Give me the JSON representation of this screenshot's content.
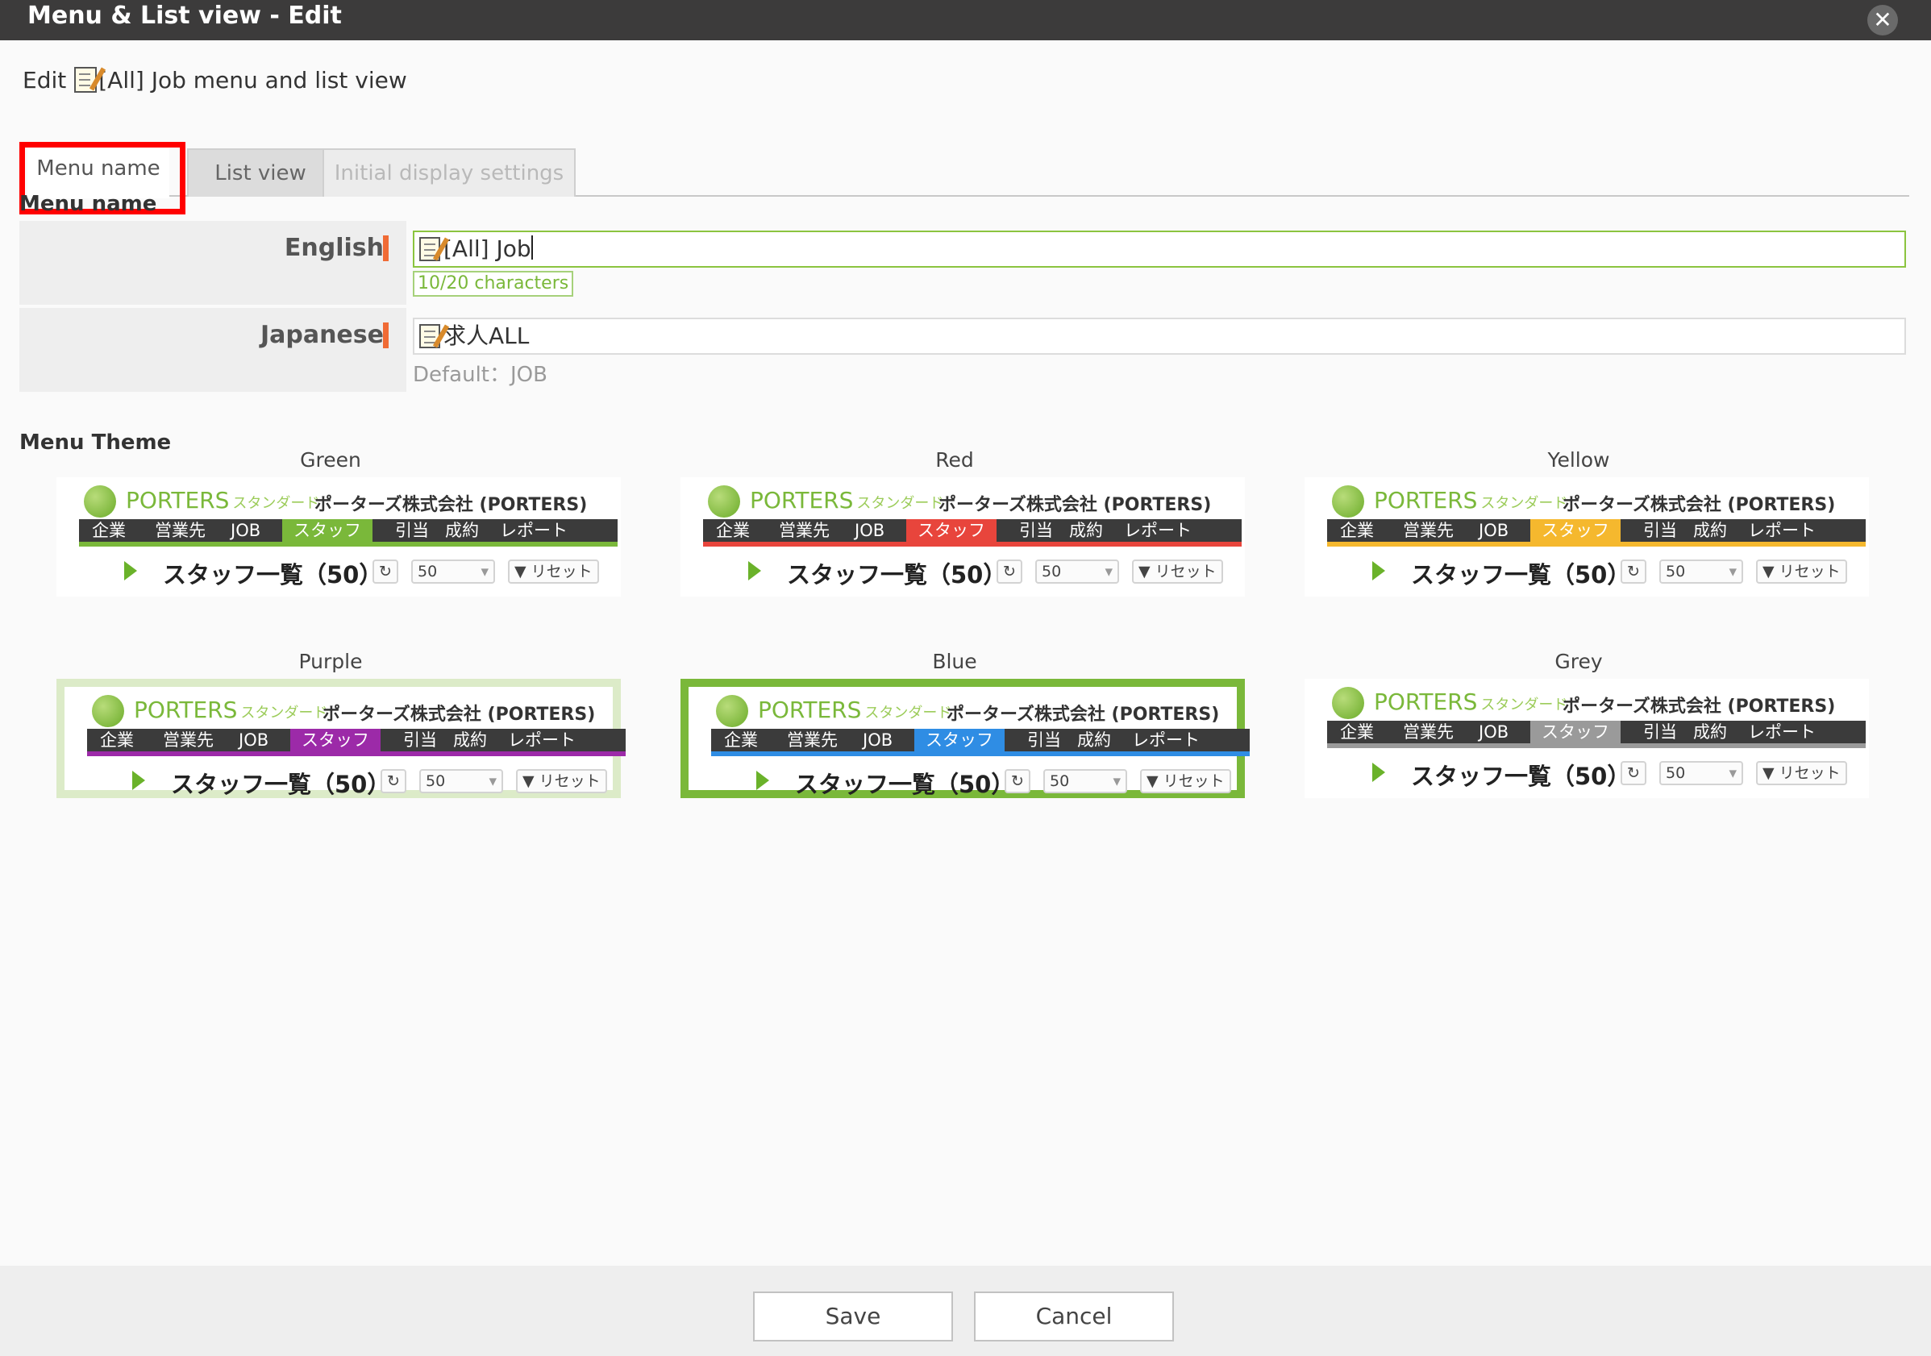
{
  "window": {
    "title": "Menu & List view - Edit",
    "close_label": "✕"
  },
  "edit": {
    "prefix": "Edit",
    "name": "[All] Job menu and list view"
  },
  "tabs": [
    {
      "label": "Menu name"
    },
    {
      "label": "List view"
    },
    {
      "label": "Initial display settings"
    }
  ],
  "menu_name": {
    "section_label": "Menu name",
    "english": {
      "label": "English",
      "value": "[All] Job",
      "char_count": "10/20 characters"
    },
    "japanese": {
      "label": "Japanese",
      "value": "求人ALL",
      "default_hint": "Default：JOB"
    }
  },
  "menu_theme": {
    "section_label": "Menu Theme",
    "preview": {
      "brand": "PORTERS",
      "brand_sub": "スタンダード",
      "company": "ポーターズ株式会社 (PORTERS)",
      "nav": [
        "企業",
        "営業先",
        "JOB",
        "スタッフ",
        "引当",
        "成約",
        "レポート"
      ],
      "list_title": "スタッフ一覧（50）",
      "refresh": "↻",
      "count": "50",
      "reset": "リセット"
    },
    "themes": [
      {
        "name": "Green",
        "color": "#7ab83a"
      },
      {
        "name": "Red",
        "color": "#e8453c"
      },
      {
        "name": "Yellow",
        "color": "#f5b82e"
      },
      {
        "name": "Purple",
        "color": "#9c2aa8"
      },
      {
        "name": "Blue",
        "color": "#2f8de4",
        "selected": true
      },
      {
        "name": "Grey",
        "color": "#9a9a9a"
      }
    ]
  },
  "footer": {
    "save": "Save",
    "cancel": "Cancel"
  }
}
